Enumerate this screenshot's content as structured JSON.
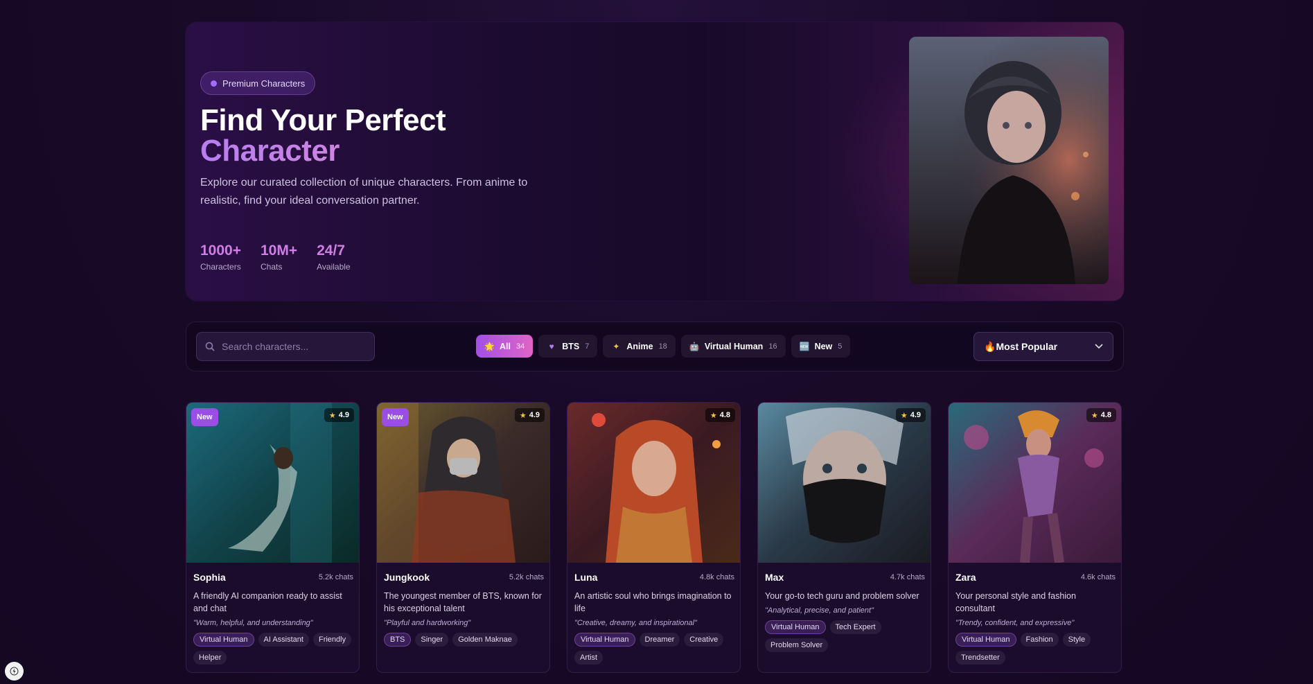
{
  "hero": {
    "badge": "Premium Characters",
    "title_line1": "Find Your Perfect",
    "title_line2": "Character",
    "description": "Explore our curated collection of unique characters. From anime to realistic, find your ideal conversation partner.",
    "stats": [
      {
        "value": "1000+",
        "label": "Characters"
      },
      {
        "value": "10M+",
        "label": "Chats"
      },
      {
        "value": "24/7",
        "label": "Available"
      }
    ]
  },
  "filters": {
    "search_placeholder": "Search characters...",
    "tabs": [
      {
        "icon": "star-icon",
        "label": "All",
        "count": "34"
      },
      {
        "icon": "heart-icon",
        "label": "BTS",
        "count": "7"
      },
      {
        "icon": "sparkle-icon",
        "label": "Anime",
        "count": "18"
      },
      {
        "icon": "robot-icon",
        "label": "Virtual Human",
        "count": "16"
      },
      {
        "icon": "new-icon",
        "label": "New",
        "count": "5"
      }
    ],
    "sort_label": "Most Popular",
    "sort_icon": "🔥"
  },
  "cards": [
    {
      "new": "New",
      "rating": "4.9",
      "name": "Sophia",
      "chats": "5.2k chats",
      "desc": "A friendly AI companion ready to assist and chat",
      "quote": "\"Warm, helpful, and understanding\"",
      "tags": [
        "Virtual Human",
        "AI Assistant",
        "Friendly",
        "Helper"
      ]
    },
    {
      "new": "New",
      "rating": "4.9",
      "name": "Jungkook",
      "chats": "5.2k chats",
      "desc": "The youngest member of BTS, known for his exceptional talent",
      "quote": "\"Playful and hardworking\"",
      "tags": [
        "BTS",
        "Singer",
        "Golden Maknae"
      ]
    },
    {
      "new": "",
      "rating": "4.8",
      "name": "Luna",
      "chats": "4.8k chats",
      "desc": "An artistic soul who brings imagination to life",
      "quote": "\"Creative, dreamy, and inspirational\"",
      "tags": [
        "Virtual Human",
        "Dreamer",
        "Creative",
        "Artist"
      ]
    },
    {
      "new": "",
      "rating": "4.9",
      "name": "Max",
      "chats": "4.7k chats",
      "desc": "Your go-to tech guru and problem solver",
      "quote": "\"Analytical, precise, and patient\"",
      "tags": [
        "Virtual Human",
        "Tech Expert",
        "Problem Solver"
      ]
    },
    {
      "new": "",
      "rating": "4.8",
      "name": "Zara",
      "chats": "4.6k chats",
      "desc": "Your personal style and fashion consultant",
      "quote": "\"Trendy, confident, and expressive\"",
      "tags": [
        "Virtual Human",
        "Fashion",
        "Style",
        "Trendsetter"
      ]
    }
  ]
}
